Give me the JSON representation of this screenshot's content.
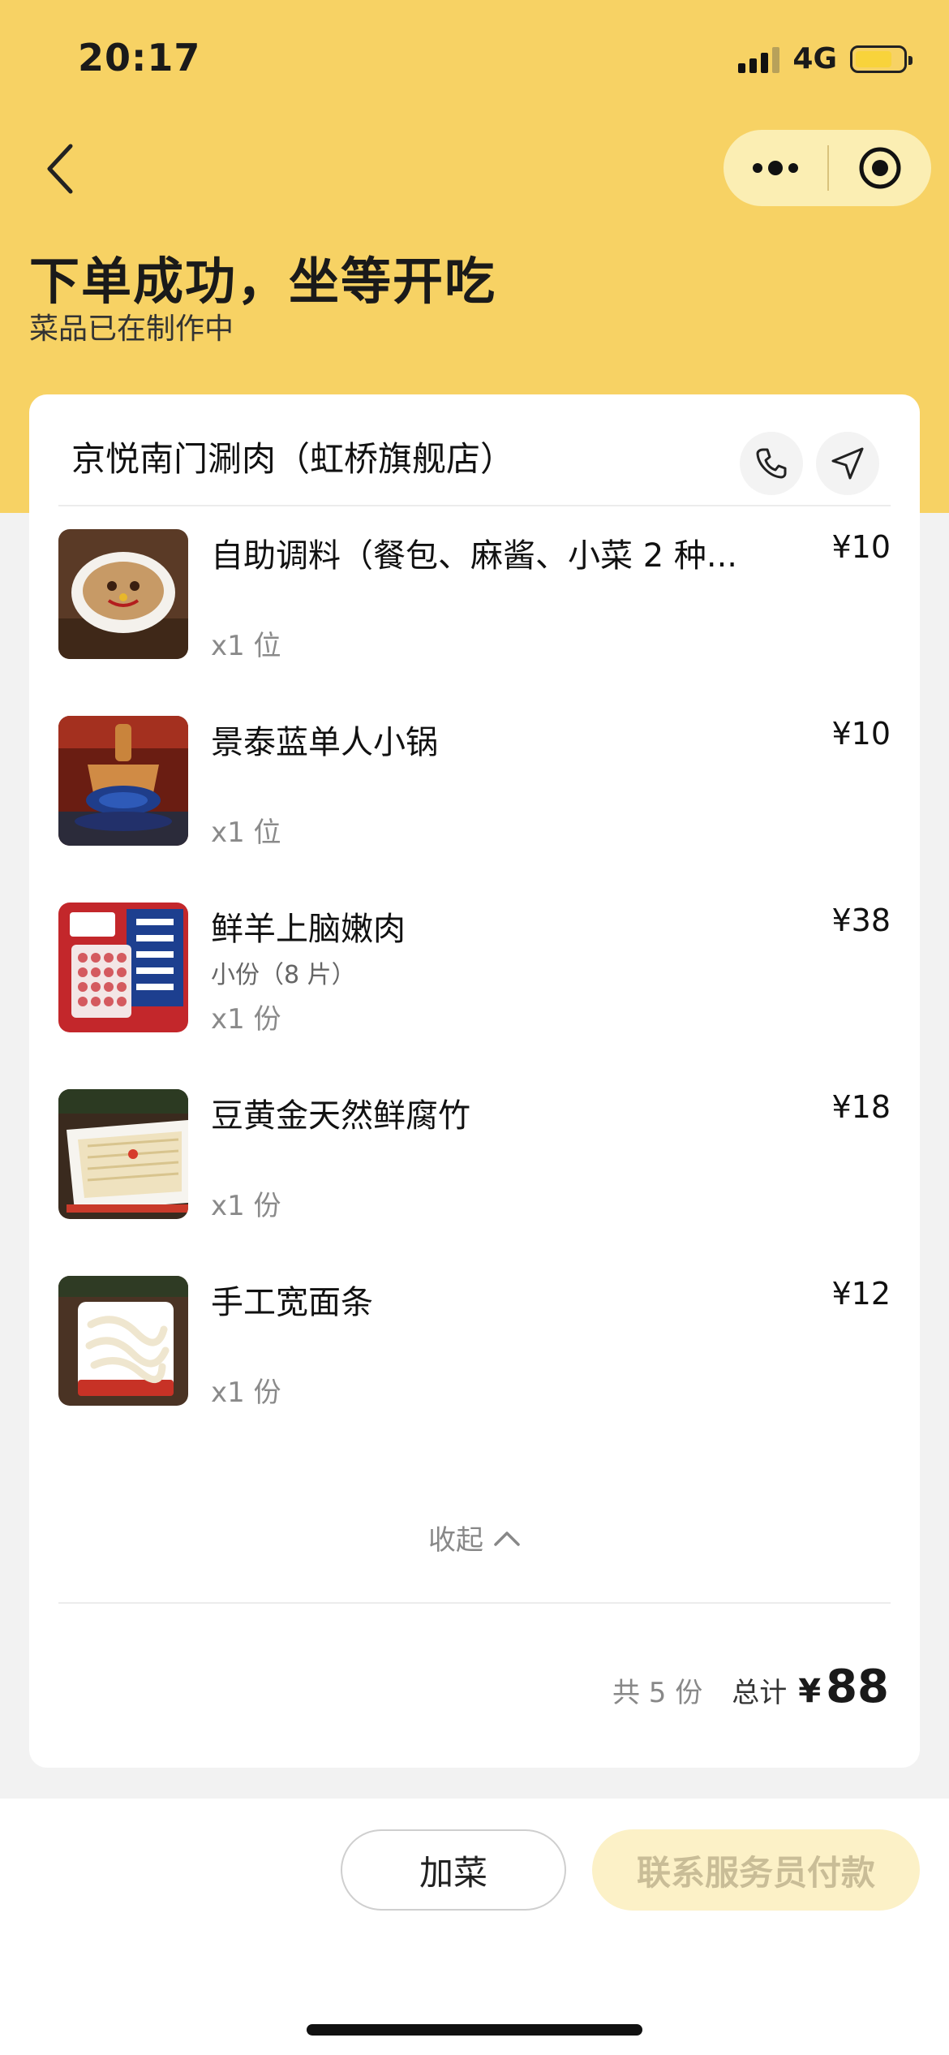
{
  "status_bar": {
    "time": "20:17",
    "network": "4G"
  },
  "header": {
    "title": "下单成功，坐等开吃",
    "subtitle": "菜品已在制作中"
  },
  "store": {
    "name": "京悦南门涮肉（虹桥旗舰店）"
  },
  "items": [
    {
      "name": "自助调料（餐包、麻酱、小菜 2 种...",
      "spec": "",
      "qty": "x1 位",
      "price": "¥10"
    },
    {
      "name": "景泰蓝单人小锅",
      "spec": "",
      "qty": "x1 位",
      "price": "¥10"
    },
    {
      "name": "鲜羊上脑嫩肉",
      "spec": "小份（8 片）",
      "qty": "x1 份",
      "price": "¥38"
    },
    {
      "name": "豆黄金天然鲜腐竹",
      "spec": "",
      "qty": "x1 份",
      "price": "¥18"
    },
    {
      "name": "手工宽面条",
      "spec": "",
      "qty": "x1 份",
      "price": "¥12"
    }
  ],
  "collapse_label": "收起",
  "summary": {
    "count": "共 5 份",
    "total_label": "总计",
    "currency": "¥",
    "total": "88"
  },
  "buttons": {
    "add_dish": "加菜",
    "pay": "联系服务员付款"
  },
  "colors": {
    "brand_yellow": "#f7d264",
    "pay_button_disabled": "#fcf1c7"
  },
  "icons": [
    "back-arrow-icon",
    "more-dots-icon",
    "close-target-icon",
    "phone-icon",
    "navigate-arrow-icon",
    "chevron-up-icon"
  ]
}
